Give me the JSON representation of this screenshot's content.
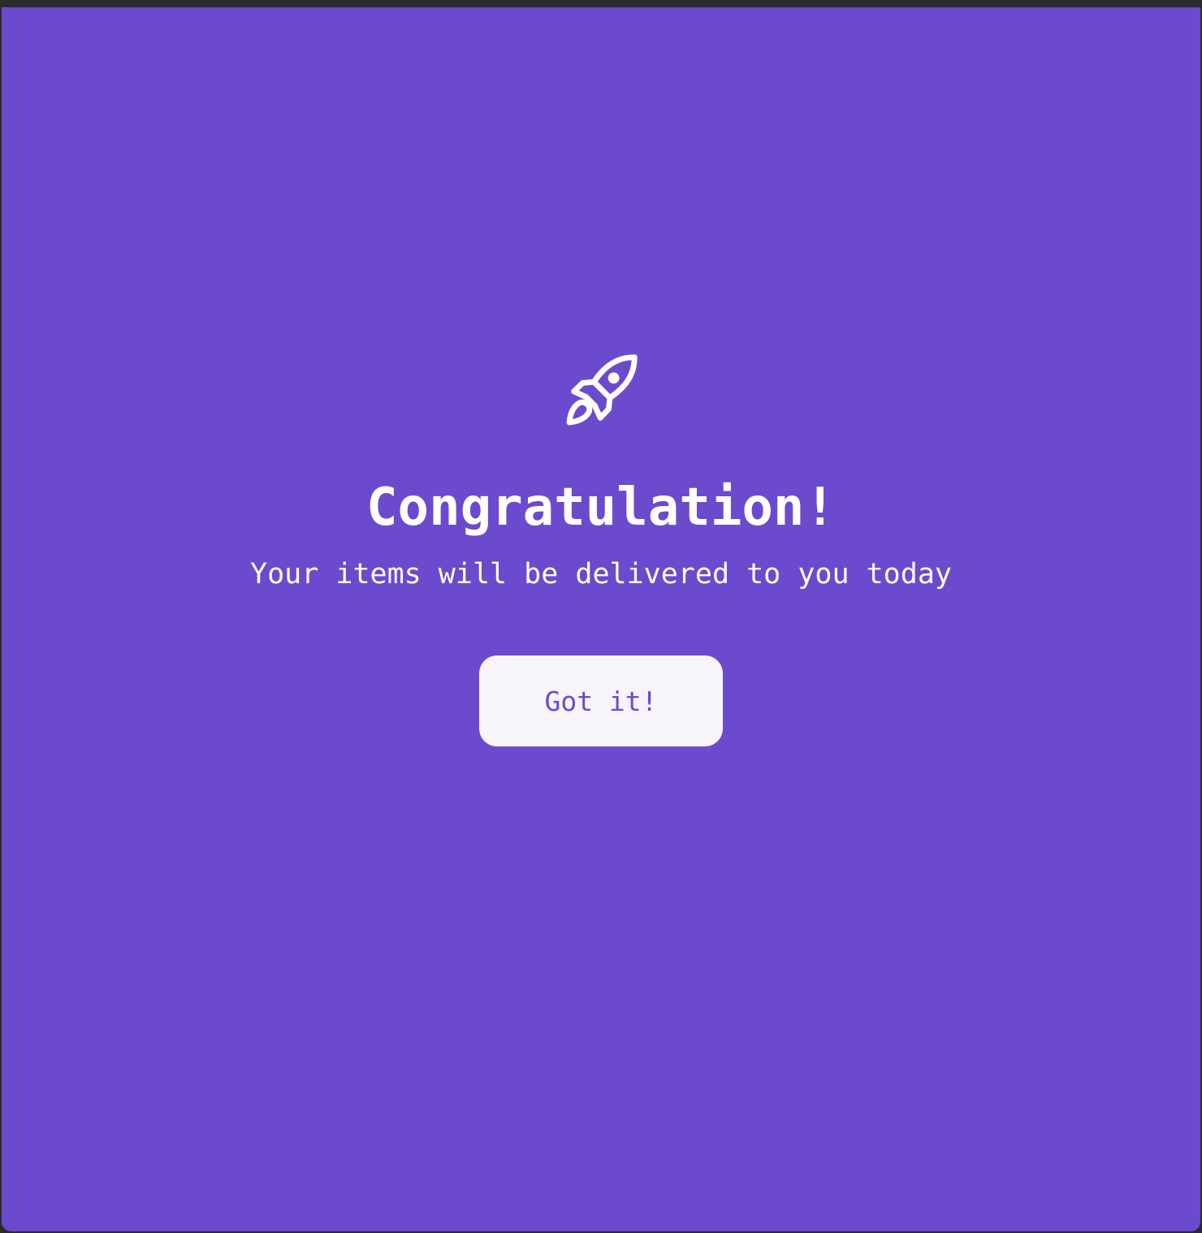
{
  "dialog": {
    "icon": "rocket-icon",
    "title": "Congratulation!",
    "message": "Your items will be delivered to you today",
    "button_label": "Got it!"
  },
  "colors": {
    "background": "#6c4acd",
    "text": "#ffffff",
    "button_background": "#f7f5fb",
    "button_text": "#6c4acd"
  }
}
